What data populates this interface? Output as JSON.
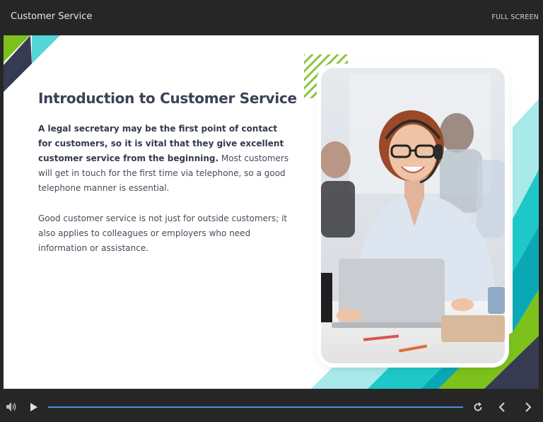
{
  "header": {
    "title": "Customer Service",
    "fullscreen_label": "FULL SCREEN"
  },
  "slide": {
    "heading": "Introduction to Customer Service",
    "para1_bold": "A legal secretary may be the first point of contact for customers, so it is vital that they give excellent customer service from the beginning.",
    "para1_rest": " Most customers will get in touch for the first time via telephone, so a good telephone manner is essential.",
    "para2": "Good customer service is not just for outside customers; it also applies to colleagues or employers who need information or assistance.",
    "accent_colors": {
      "lime": "#7cc11c",
      "teal": "#1ec8c8",
      "light_teal": "#a9e9ea",
      "navy": "#363b52",
      "dark_teal": "#0aa8b5"
    }
  },
  "player": {
    "icons": [
      "volume-icon",
      "play-icon",
      "replay-icon",
      "prev-icon",
      "next-icon"
    ],
    "progress_color": "#4a90d9"
  }
}
